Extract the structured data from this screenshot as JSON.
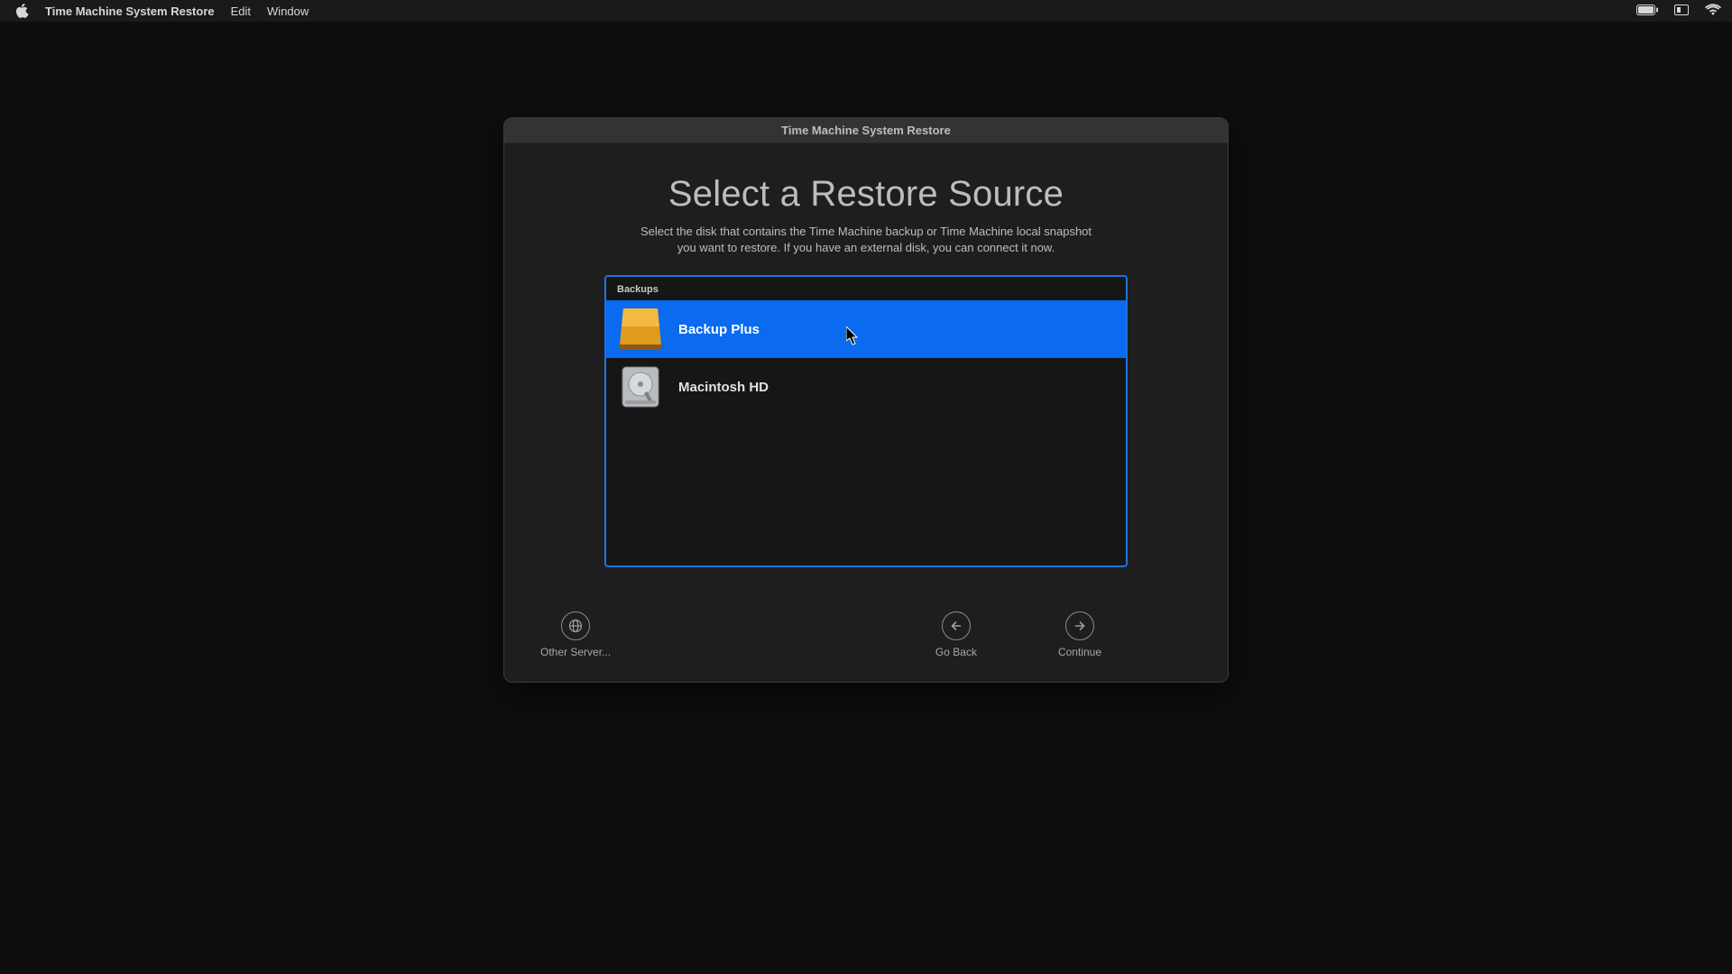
{
  "menubar": {
    "app_name": "Time Machine System Restore",
    "menus": {
      "edit": "Edit",
      "window": "Window"
    }
  },
  "window": {
    "title": "Time Machine System Restore",
    "headline": "Select a Restore Source",
    "subhead_line1": "Select the disk that contains the Time Machine backup or Time Machine local snapshot",
    "subhead_line2": "you want to restore. If you have an external disk, you can connect it now.",
    "list_header": "Backups",
    "sources": [
      {
        "label": "Backup Plus",
        "icon": "external-drive-icon",
        "selected": true
      },
      {
        "label": "Macintosh HD",
        "icon": "internal-drive-icon",
        "selected": false
      }
    ],
    "buttons": {
      "other_server": "Other Server...",
      "go_back": "Go Back",
      "continue": "Continue"
    }
  }
}
